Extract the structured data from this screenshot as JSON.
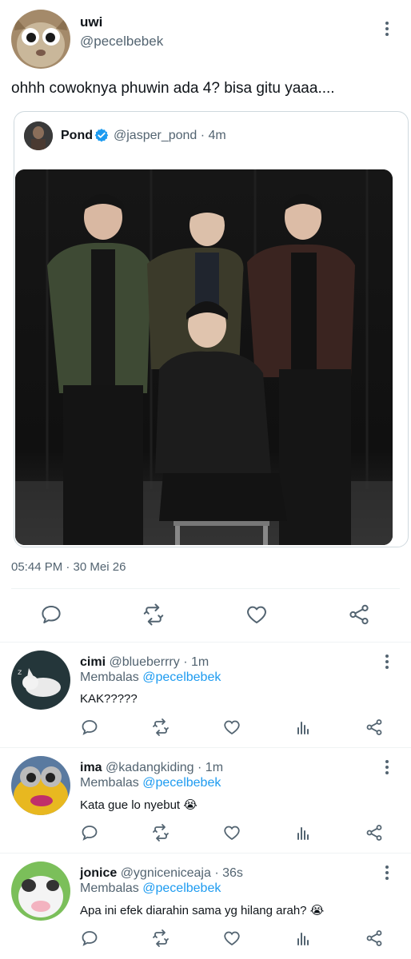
{
  "main_tweet": {
    "author_name": "uwi",
    "author_handle": "@pecelbebek",
    "text": "ohhh cowoknya phuwin ada 4? bisa gitu yaaa....",
    "timestamp": "05:44 PM · 30 Mei 26",
    "more_icon": "more-vertical-icon"
  },
  "quoted_tweet": {
    "author_name": "Pond",
    "author_handle": "@jasper_pond · 4m",
    "verified_icon": "verified-badge-icon",
    "photo_icon": "photo"
  },
  "actions": {
    "reply": "reply-icon",
    "retweet": "retweet-icon",
    "like": "like-icon",
    "share": "share-icon",
    "stats": "stats-icon"
  },
  "replies": [
    {
      "name": "cimi",
      "handle": "@blueberrry · 1m",
      "replying_label": "Membalas",
      "replying_to": "@pecelbebek",
      "text": "KAK?????",
      "emoji": ""
    },
    {
      "name": "ima",
      "handle": "@kadangkiding · 1m",
      "replying_label": "Membalas",
      "replying_to": "@pecelbebek",
      "text": "Kata gue lo nyebut ",
      "emoji": "😭"
    },
    {
      "name": "jonice",
      "handle": "@ygniceniceaja · 36s",
      "replying_label": "Membalas",
      "replying_to": "@pecelbebek",
      "text": "Apa ini efek diarahin sama yg hilang arah? ",
      "emoji": "😭"
    }
  ],
  "colors": {
    "text": "#0f1419",
    "secondary": "#536471",
    "link": "#1d9bf0",
    "border": "#cfd9de",
    "divider": "#eff3f4"
  }
}
